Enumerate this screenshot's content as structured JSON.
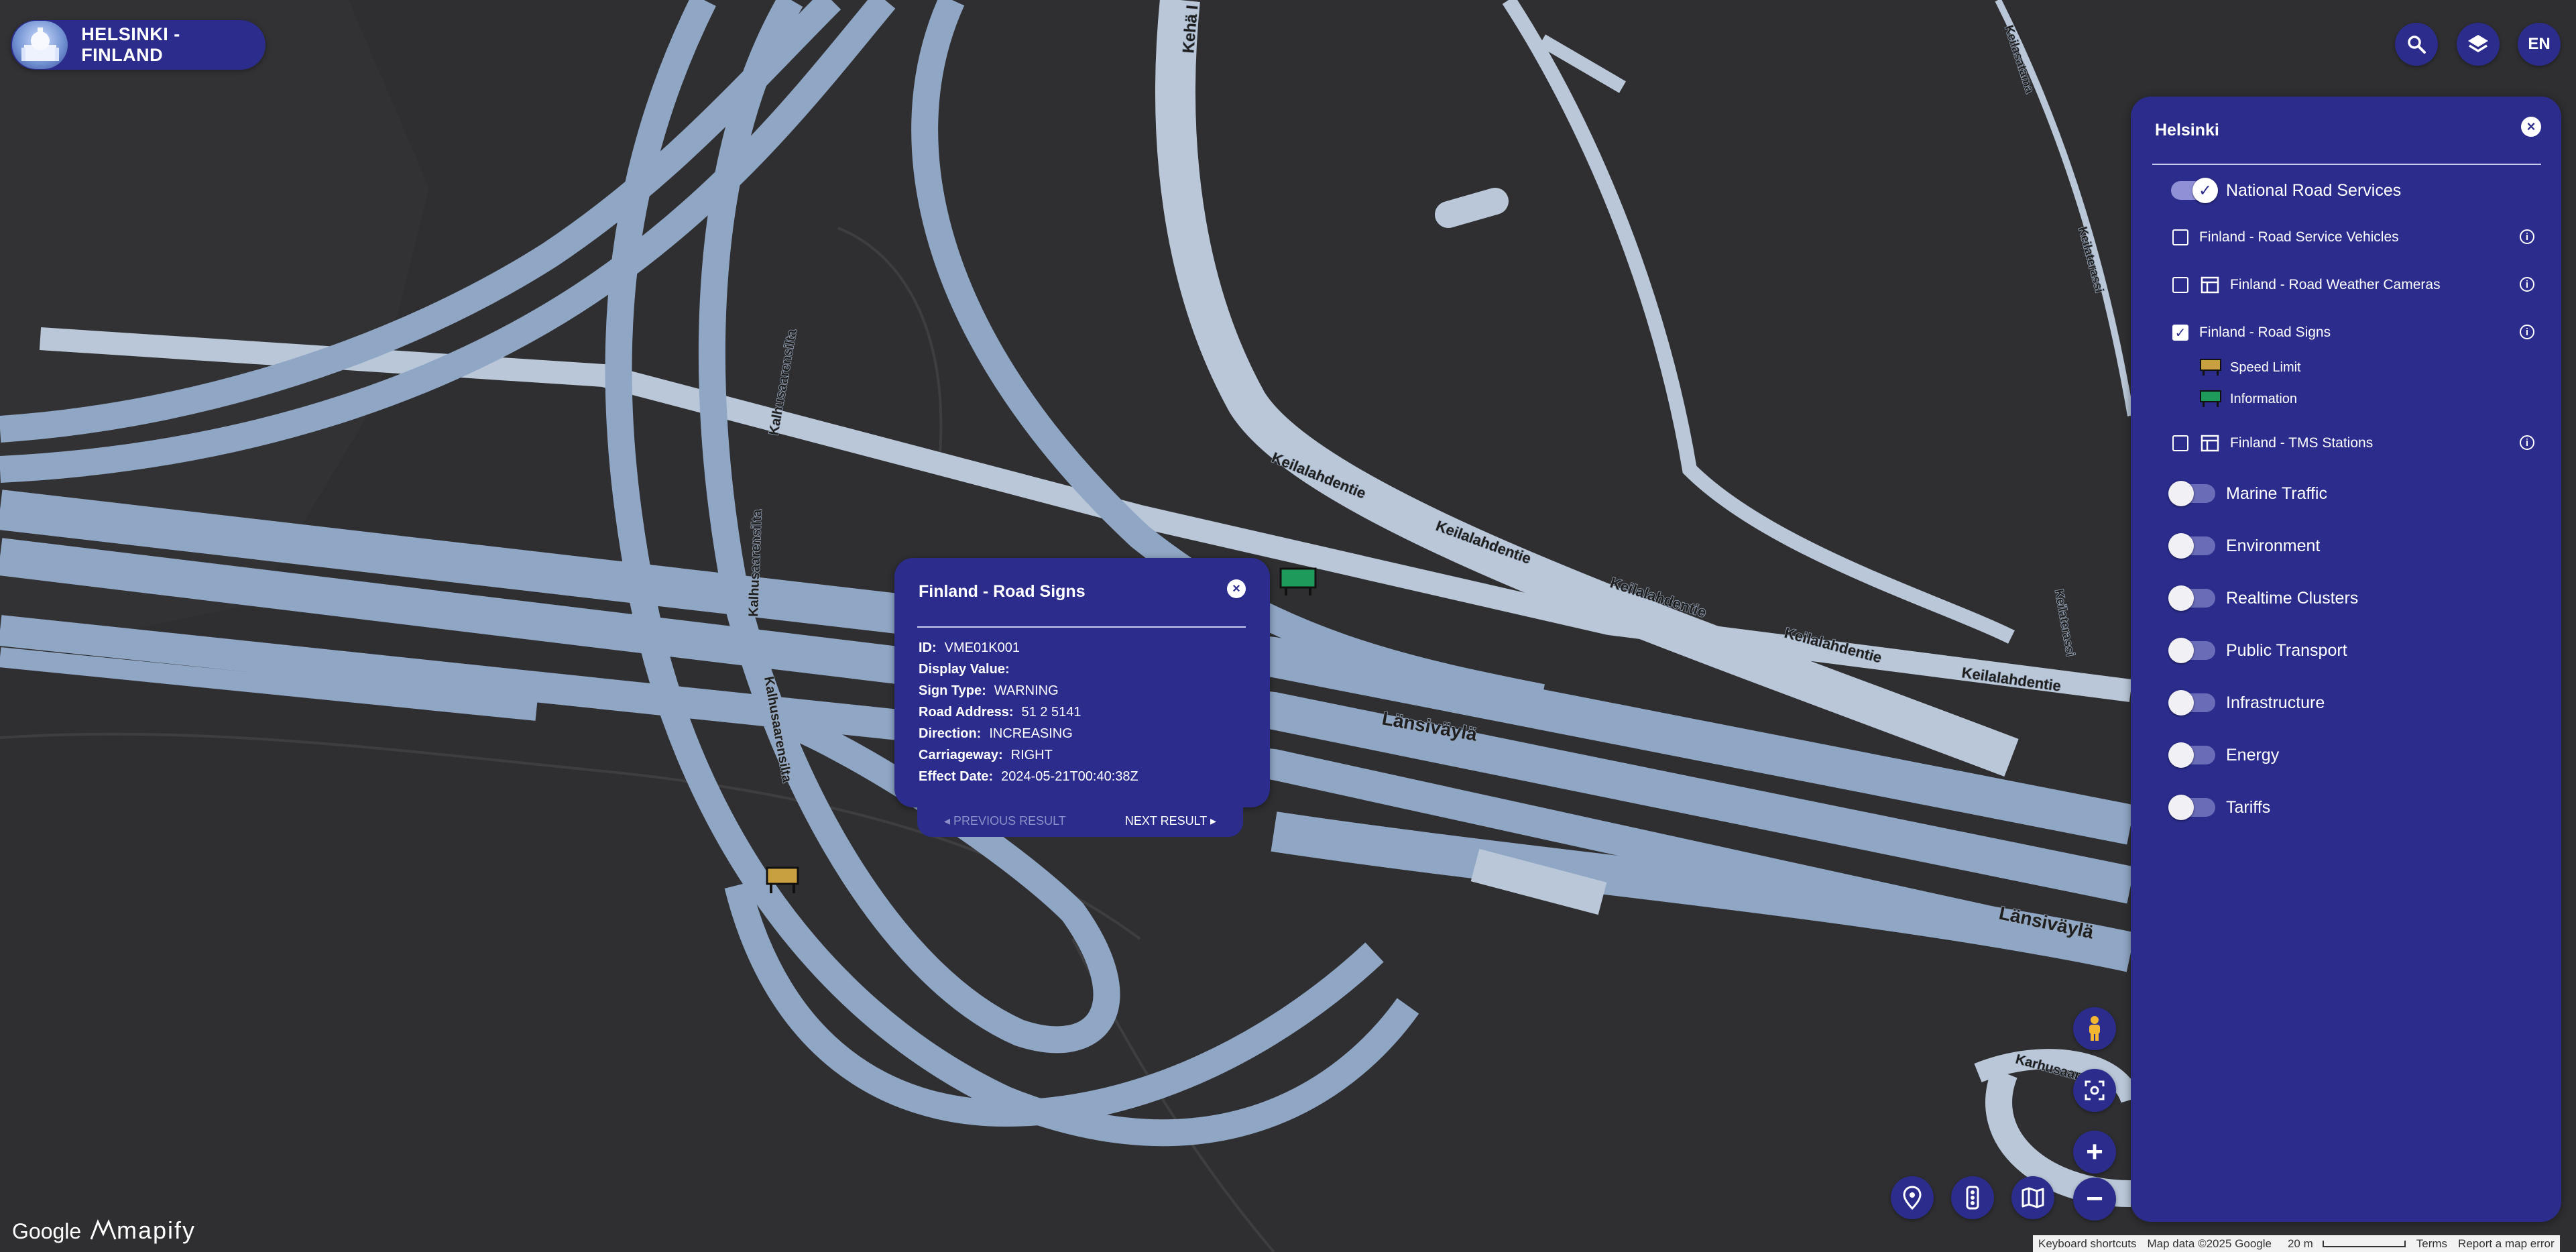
{
  "header": {
    "title": "HELSINKI - FINLAND",
    "lang": "EN"
  },
  "map": {
    "road_labels": [
      "Kehä I",
      "Kalhusaarensilta",
      "Kalhusaarensilta",
      "Kalhusaarensilta",
      "Keilalahdentie",
      "Keilalahdentie",
      "Keilalahdentie",
      "Keilalahdentie",
      "Keilalahdentie",
      "Länsiväylä",
      "Länsiväylä",
      "Keilaterassi",
      "Keilaterassi",
      "Keilasatama",
      "Karhusaarentie"
    ]
  },
  "panel": {
    "title": "Helsinki",
    "sections": [
      {
        "label": "National Road Services",
        "on": true
      },
      {
        "label": "Marine Traffic",
        "on": false
      },
      {
        "label": "Environment",
        "on": false
      },
      {
        "label": "Realtime Clusters",
        "on": false
      },
      {
        "label": "Public Transport",
        "on": false
      },
      {
        "label": "Infrastructure",
        "on": false
      },
      {
        "label": "Energy",
        "on": false
      },
      {
        "label": "Tariffs",
        "on": false
      }
    ],
    "layers": [
      {
        "label": "Finland - Road Service Vehicles",
        "checked": false,
        "table_icon": false
      },
      {
        "label": "Finland - Road Weather Cameras",
        "checked": false,
        "table_icon": true
      },
      {
        "label": "Finland - Road Signs",
        "checked": true,
        "table_icon": false
      },
      {
        "label": "Finland - TMS Stations",
        "checked": false,
        "table_icon": true
      }
    ],
    "legend": [
      {
        "label": "Speed Limit",
        "color": "#c8a040"
      },
      {
        "label": "Information",
        "color": "#1e9a5a"
      }
    ]
  },
  "popup": {
    "title": "Finland - Road Signs",
    "rows": [
      {
        "key": "ID:",
        "value": "VME01K001"
      },
      {
        "key": "Display Value:",
        "value": ""
      },
      {
        "key": "Sign Type:",
        "value": "WARNING"
      },
      {
        "key": "Road Address:",
        "value": "51 2 5141"
      },
      {
        "key": "Direction:",
        "value": "INCREASING"
      },
      {
        "key": "Carriageway:",
        "value": "RIGHT"
      },
      {
        "key": "Effect Date:",
        "value": "2024-05-21T00:40:38Z"
      }
    ],
    "prev_label": "PREVIOUS RESULT",
    "next_label": "NEXT RESULT"
  },
  "footer": {
    "google": "Google",
    "mapify": "mapify",
    "keyboard": "Keyboard shortcuts",
    "mapdata": "Map data ©2025 Google",
    "scale": "20 m",
    "terms": "Terms",
    "report": "Report a map error"
  },
  "colors": {
    "panel": "#2b2c8c",
    "map_bg": "#2f2f31",
    "road": "#8fa6c4",
    "road_light": "#b9c7d8"
  }
}
